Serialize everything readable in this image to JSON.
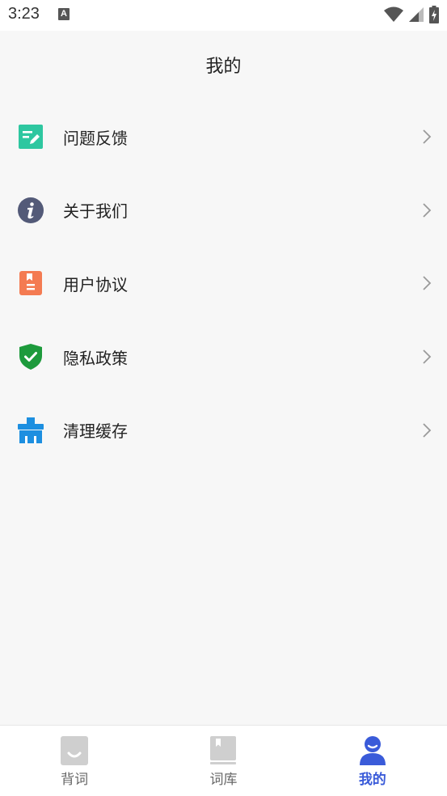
{
  "status_bar": {
    "time": "3:23",
    "a_badge": "A"
  },
  "header": {
    "title": "我的"
  },
  "menu": {
    "items": [
      {
        "label": "问题反馈",
        "icon": "feedback-icon",
        "color": "#2ec7a0"
      },
      {
        "label": "关于我们",
        "icon": "info-icon",
        "color": "#535a78"
      },
      {
        "label": "用户协议",
        "icon": "agreement-icon",
        "color": "#f47b52"
      },
      {
        "label": "隐私政策",
        "icon": "shield-check-icon",
        "color": "#1d9a3c"
      },
      {
        "label": "清理缓存",
        "icon": "broom-icon",
        "color": "#1d8fe0"
      }
    ]
  },
  "bottom_nav": {
    "items": [
      {
        "label": "背词",
        "icon": "smile-card-icon",
        "active": false
      },
      {
        "label": "词库",
        "icon": "book-icon",
        "active": false
      },
      {
        "label": "我的",
        "icon": "user-icon",
        "active": true
      }
    ],
    "active_color": "#3a5bd9",
    "inactive_color": "#cfcfcf"
  }
}
